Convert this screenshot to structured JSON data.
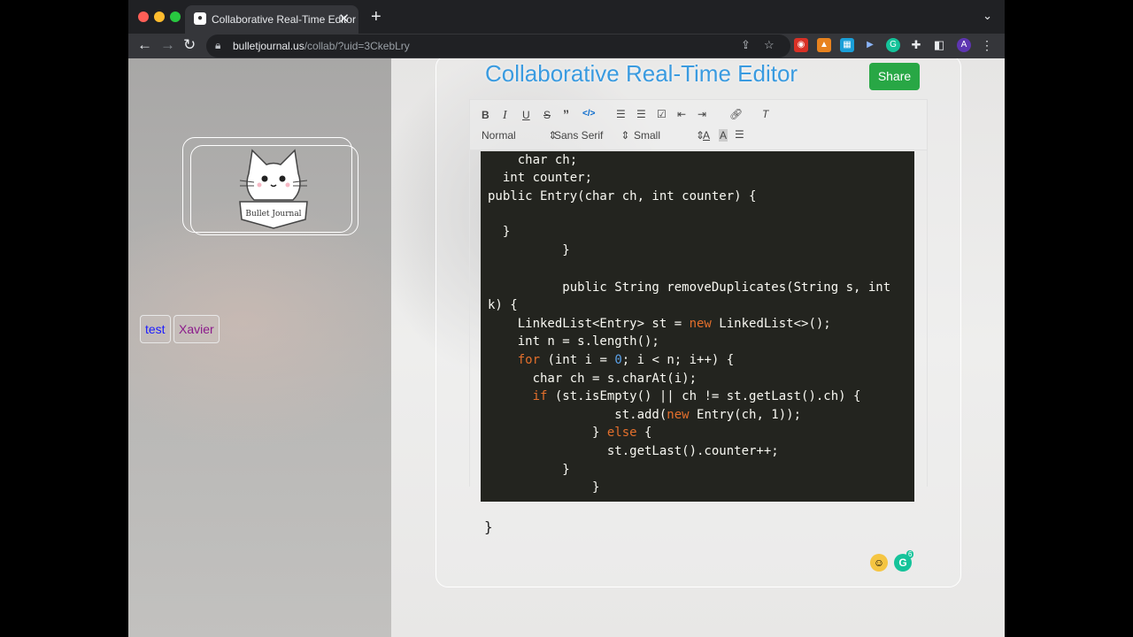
{
  "browser": {
    "tab_title": "Collaborative Real-Time Editor",
    "tab_close": "✕",
    "new_tab": "+",
    "url_host": "bulletjournal.us",
    "url_path": "/collab/?uid=3CkebLry"
  },
  "app": {
    "title": "Collaborative Real-Time Editor",
    "share_label": "Share",
    "logo_text": "Bullet Journal"
  },
  "users": [
    "test",
    "Xavier"
  ],
  "user_colors": [
    "#1a1aff",
    "#8b1a8b"
  ],
  "toolbar": {
    "header_select": "Normal",
    "font_select": "Sans Serif",
    "size_select": "Small"
  },
  "code_lines": [
    "    char ch;",
    "  int counter;",
    "public Entry(char ch, int counter) {",
    "",
    "  }",
    "          }",
    "",
    "          public String removeDuplicates(String s, int",
    "k) {",
    "    LinkedList<Entry> st = new LinkedList<>();",
    "    int n = s.length();",
    "    for (int i = 0; i < n; i++) {",
    "      char ch = s.charAt(i);",
    "      if (st.isEmpty() || ch != st.getLast().ch) {",
    "                 st.add(new Entry(ch, 1));",
    "              } else {",
    "                st.getLast().counter++;",
    "          }",
    "              }"
  ],
  "trailing_brace": "}",
  "grammarly_count": "6"
}
